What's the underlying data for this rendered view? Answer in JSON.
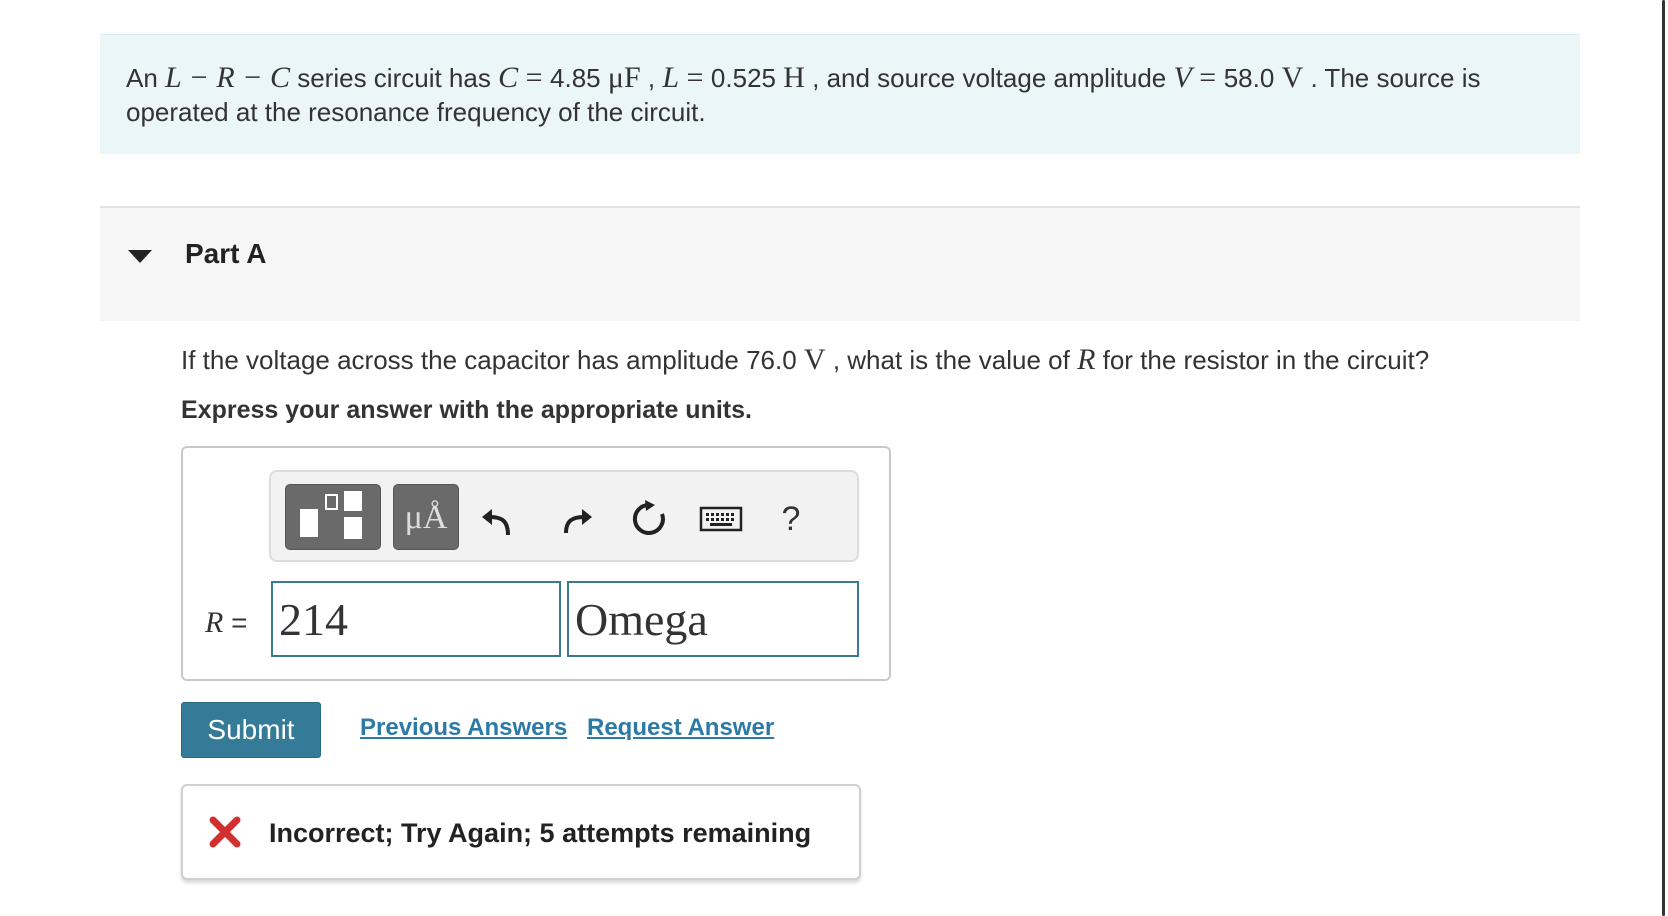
{
  "intro": {
    "p1": "An ",
    "m_lrc": "L − R − C",
    "p2": " series circuit has ",
    "m_c": "C",
    "eq1": " = ",
    "c_value": "4.85",
    "c_unit": "μF",
    "sep1": " , ",
    "m_l": "L",
    "eq2": " = ",
    "l_value": "0.525",
    "l_unit": "H",
    "p3": " , and source voltage amplitude ",
    "m_v": "V",
    "eq3": " = ",
    "v_value": "58.0",
    "v_unit": "V",
    "p4": " . The source is operated at the resonance frequency of the circuit."
  },
  "part": {
    "title": "Part A"
  },
  "question": {
    "q1": "If the voltage across the capacitor has amplitude 76.0 ",
    "q_unit": "V",
    "q2": " , what is the value of ",
    "q_var": "R",
    "q3": " for the resistor in the circuit?",
    "instruction": "Express your answer with the appropriate units."
  },
  "toolbar": {
    "units_label": "μÅ",
    "help_label": "?"
  },
  "answer": {
    "var": "R",
    "equals": " =",
    "value": "214",
    "units": "Omega"
  },
  "actions": {
    "submit_label": "Submit",
    "previous_answers_label": "Previous Answers",
    "request_answer_label": "Request Answer"
  },
  "feedback": {
    "text": "Incorrect; Try Again; 5 attempts remaining"
  },
  "colors": {
    "accent": "#357a97",
    "link": "#2c7aa5",
    "intro_bg": "#eaf6f7",
    "error": "#d22f2f"
  }
}
